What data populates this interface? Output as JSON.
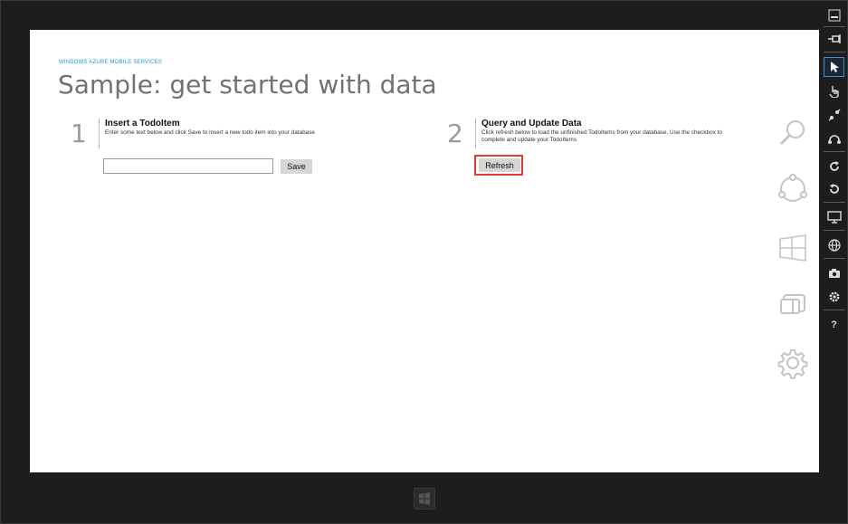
{
  "app": {
    "brand": "WINDOWS AZURE MOBILE SERVICES",
    "title": "Sample: get started with data"
  },
  "step1": {
    "number": "1",
    "heading": "Insert a TodoItem",
    "description": "Enter some text below and click Save to insert a new todo item into your database",
    "input_value": "",
    "save_label": "Save"
  },
  "step2": {
    "number": "2",
    "heading": "Query and Update Data",
    "description_line1": "Click refresh below to load the unfinished TodoItems from your database. Use the checkbox to",
    "description_line2": "complete and update your TodoItems",
    "refresh_label": "Refresh"
  },
  "charms": [
    "search-icon",
    "share-icon",
    "start-icon",
    "devices-icon",
    "settings-icon"
  ],
  "simulator_toolbar": {
    "items": [
      "minimize-icon",
      "pin-icon",
      "mouse-mode-icon",
      "touch-mode-icon",
      "pinch-zoom-icon",
      "rotation-gesture-icon",
      "rotate-clockwise-icon",
      "rotate-counterclockwise-icon",
      "change-resolution-icon",
      "set-location-icon",
      "screenshot-icon",
      "screenshot-settings-icon",
      "help-icon"
    ],
    "help_glyph": "?"
  },
  "colors": {
    "accent": "#1b9ad6",
    "highlight": "#e03c31",
    "button": "#d6d6d6",
    "bezel": "#1d1d1d"
  }
}
